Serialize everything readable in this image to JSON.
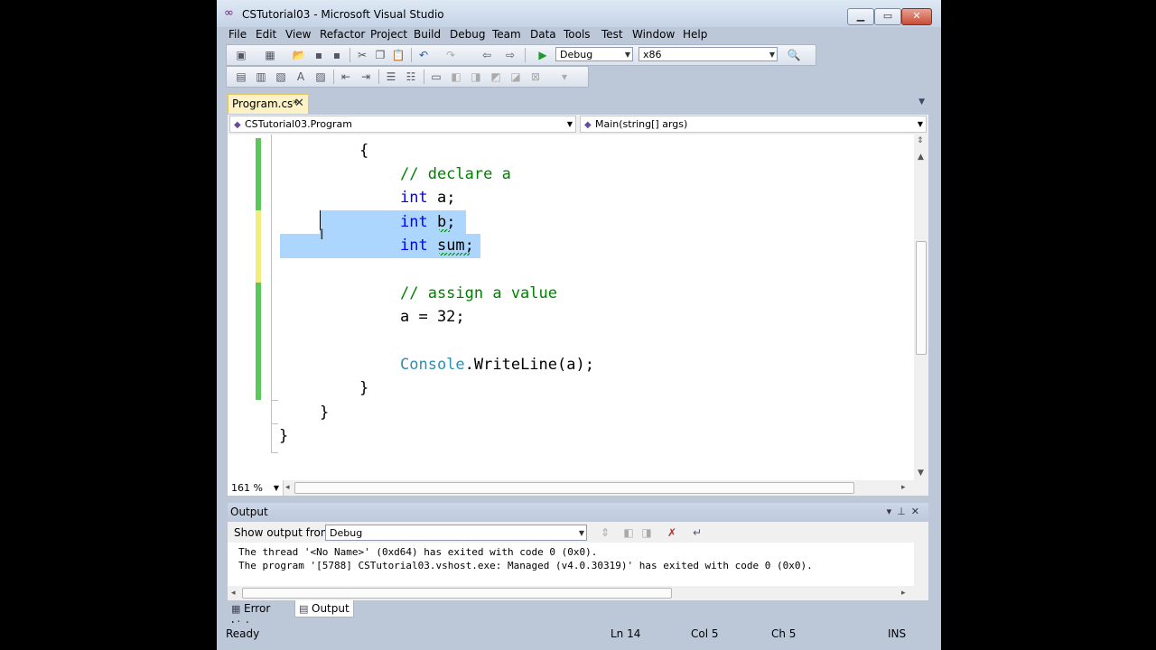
{
  "window": {
    "title": "CSTutorial03 - Microsoft Visual Studio"
  },
  "menu": [
    "File",
    "Edit",
    "View",
    "Refactor",
    "Project",
    "Build",
    "Debug",
    "Team",
    "Data",
    "Tools",
    "Test",
    "Window",
    "Help"
  ],
  "toolbar": {
    "config": "Debug",
    "platform": "x86"
  },
  "doc_tab": {
    "label": "Program.cs*",
    "close": "✕"
  },
  "navbar": {
    "type_combo": "CSTutorial03.Program",
    "member_combo": "Main(string[] args)"
  },
  "code": {
    "open_brace": "{",
    "comment_declare": "// declare a",
    "kw_int": "int",
    "var_a": " a;",
    "var_b": " b;",
    "var_sum": " sum;",
    "comment_assign": "// assign a value",
    "assign_a": "a = 32;",
    "console_type": "Console",
    "console_call": ".WriteLine(a);",
    "close_brace_method": "}",
    "close_brace_class": "}",
    "close_brace_ns": "}"
  },
  "editor": {
    "zoom": "161 %"
  },
  "output_panel": {
    "title": "Output",
    "show_from_label": "Show output from:",
    "source": "Debug",
    "lines": [
      "The thread '<No Name>' (0xd64) has exited with code 0 (0x0).",
      "The program '[5788] CSTutorial03.vshost.exe: Managed (v4.0.30319)' has exited with code 0 (0x0)."
    ]
  },
  "bottom_tabs": [
    "Error List",
    "Output"
  ],
  "status": {
    "state": "Ready",
    "line": "Ln 14",
    "col": "Col 5",
    "ch": "Ch 5",
    "mode": "INS"
  },
  "colors": {
    "keyword": "#0000ff",
    "comment": "#008000",
    "type": "#2b91af",
    "selection": "#add6ff"
  }
}
